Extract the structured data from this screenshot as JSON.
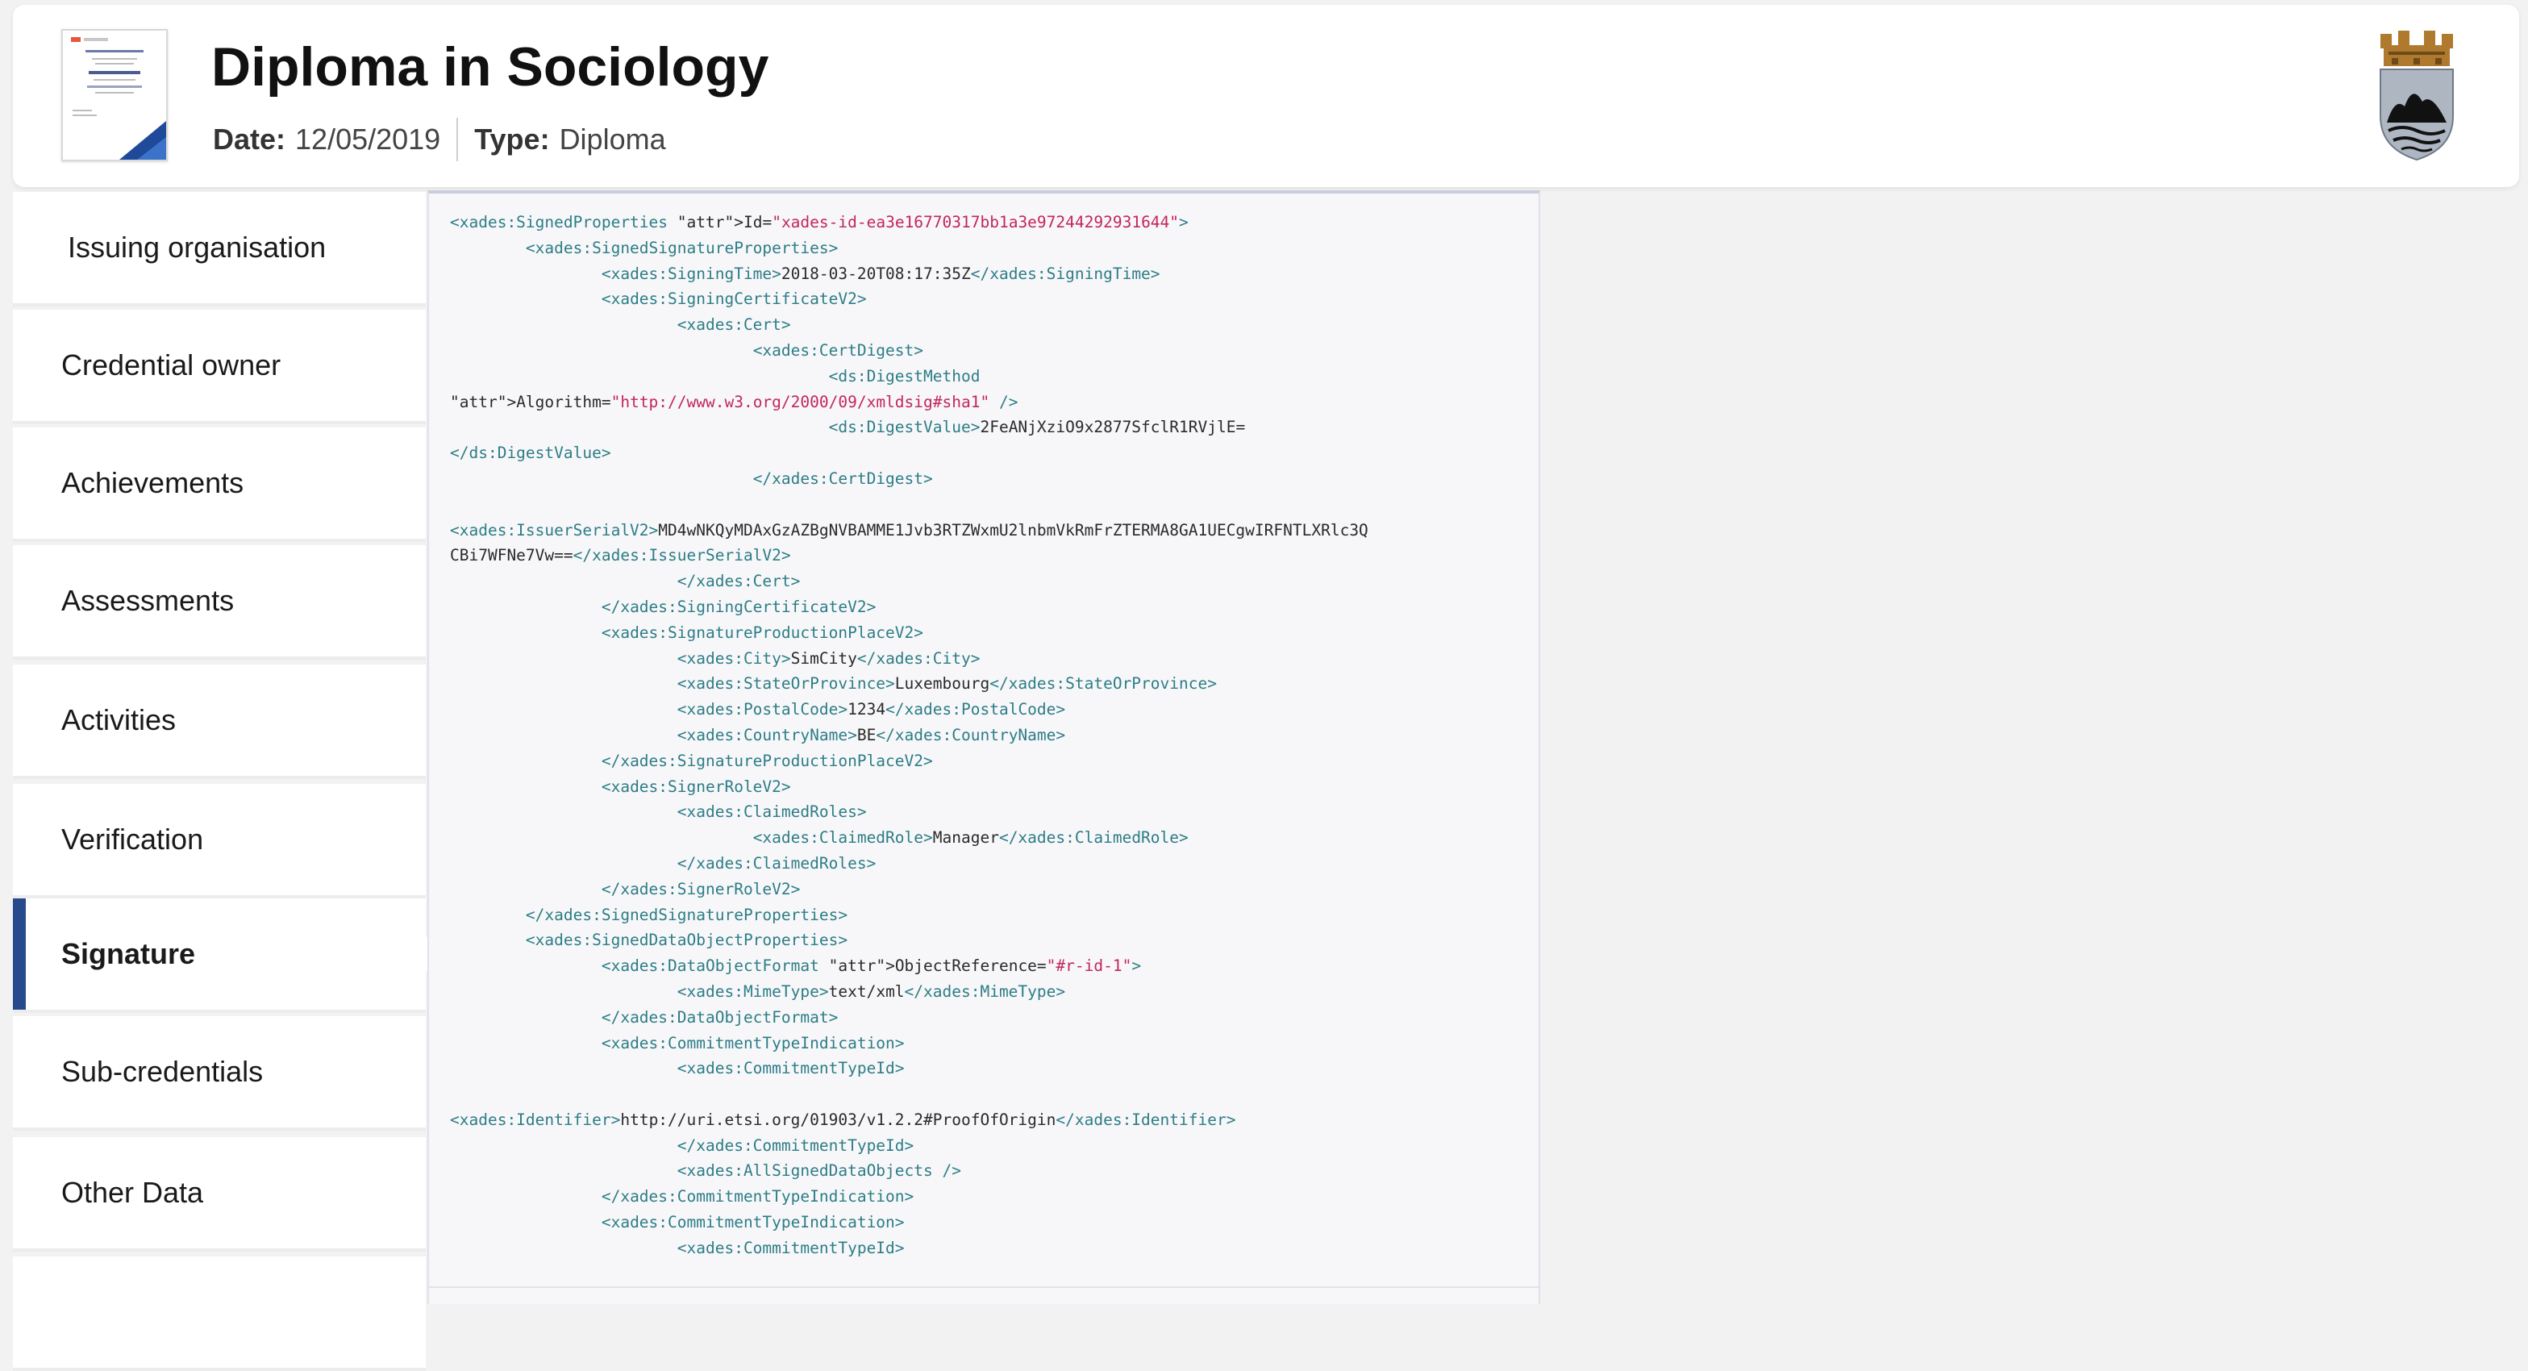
{
  "header": {
    "title": "Diploma in Sociology",
    "date_label": "Date:",
    "date_value": "12/05/2019",
    "type_label": "Type:",
    "type_value": "Diploma"
  },
  "sidebar": {
    "items": [
      {
        "label": "Issuing organisation",
        "active": false
      },
      {
        "label": "Credential owner",
        "active": false
      },
      {
        "label": "Achievements",
        "active": false
      },
      {
        "label": "Assessments",
        "active": false
      },
      {
        "label": "Activities",
        "active": false
      },
      {
        "label": "Verification",
        "active": false
      },
      {
        "label": "Signature",
        "active": true
      },
      {
        "label": "Sub-credentials",
        "active": false
      },
      {
        "label": "Other Data",
        "active": false
      }
    ]
  },
  "code": {
    "lines": [
      "<xades:SignedProperties Id=\"xades-id-ea3e16770317bb1a3e97244292931644\">",
      "        <xades:SignedSignatureProperties>",
      "                <xades:SigningTime>2018-03-20T08:17:35Z</xades:SigningTime>",
      "                <xades:SigningCertificateV2>",
      "                        <xades:Cert>",
      "                                <xades:CertDigest>",
      "                                        <ds:DigestMethod",
      "Algorithm=\"http://www.w3.org/2000/09/xmldsig#sha1\" />",
      "                                        <ds:DigestValue>2FeANjXziO9x2877SfclR1RVjlE=",
      "</ds:DigestValue>",
      "                                </xades:CertDigest>",
      "",
      "<xades:IssuerSerialV2>MD4wNKQyMDAxGzAZBgNVBAMME1Jvb3RTZWxmU2lnbmVkRmFrZTERMA8GA1UECgwIRFNTLXRlc3Q",
      "CBi7WFNe7Vw==</xades:IssuerSerialV2>",
      "                        </xades:Cert>",
      "                </xades:SigningCertificateV2>",
      "                <xades:SignatureProductionPlaceV2>",
      "                        <xades:City>SimCity</xades:City>",
      "                        <xades:StateOrProvince>Luxembourg</xades:StateOrProvince>",
      "                        <xades:PostalCode>1234</xades:PostalCode>",
      "                        <xades:CountryName>BE</xades:CountryName>",
      "                </xades:SignatureProductionPlaceV2>",
      "                <xades:SignerRoleV2>",
      "                        <xades:ClaimedRoles>",
      "                                <xades:ClaimedRole>Manager</xades:ClaimedRole>",
      "                        </xades:ClaimedRoles>",
      "                </xades:SignerRoleV2>",
      "        </xades:SignedSignatureProperties>",
      "        <xades:SignedDataObjectProperties>",
      "                <xades:DataObjectFormat ObjectReference=\"#r-id-1\">",
      "                        <xades:MimeType>text/xml</xades:MimeType>",
      "                </xades:DataObjectFormat>",
      "                <xades:CommitmentTypeIndication>",
      "                        <xades:CommitmentTypeId>",
      "",
      "<xades:Identifier>http://uri.etsi.org/01903/v1.2.2#ProofOfOrigin</xades:Identifier>",
      "                        </xades:CommitmentTypeId>",
      "                        <xades:AllSignedDataObjects />",
      "                </xades:CommitmentTypeIndication>",
      "                <xades:CommitmentTypeIndication>",
      "                        <xades:CommitmentTypeId>"
    ]
  },
  "colors": {
    "accent": "#274a8c",
    "xml_tag": "#2d7d86",
    "xml_attr": "#30318f",
    "xml_value": "#c3255e"
  },
  "icons": {
    "thumbnail": "certificate-thumbnail",
    "logo": "municipal-crest-logo"
  }
}
